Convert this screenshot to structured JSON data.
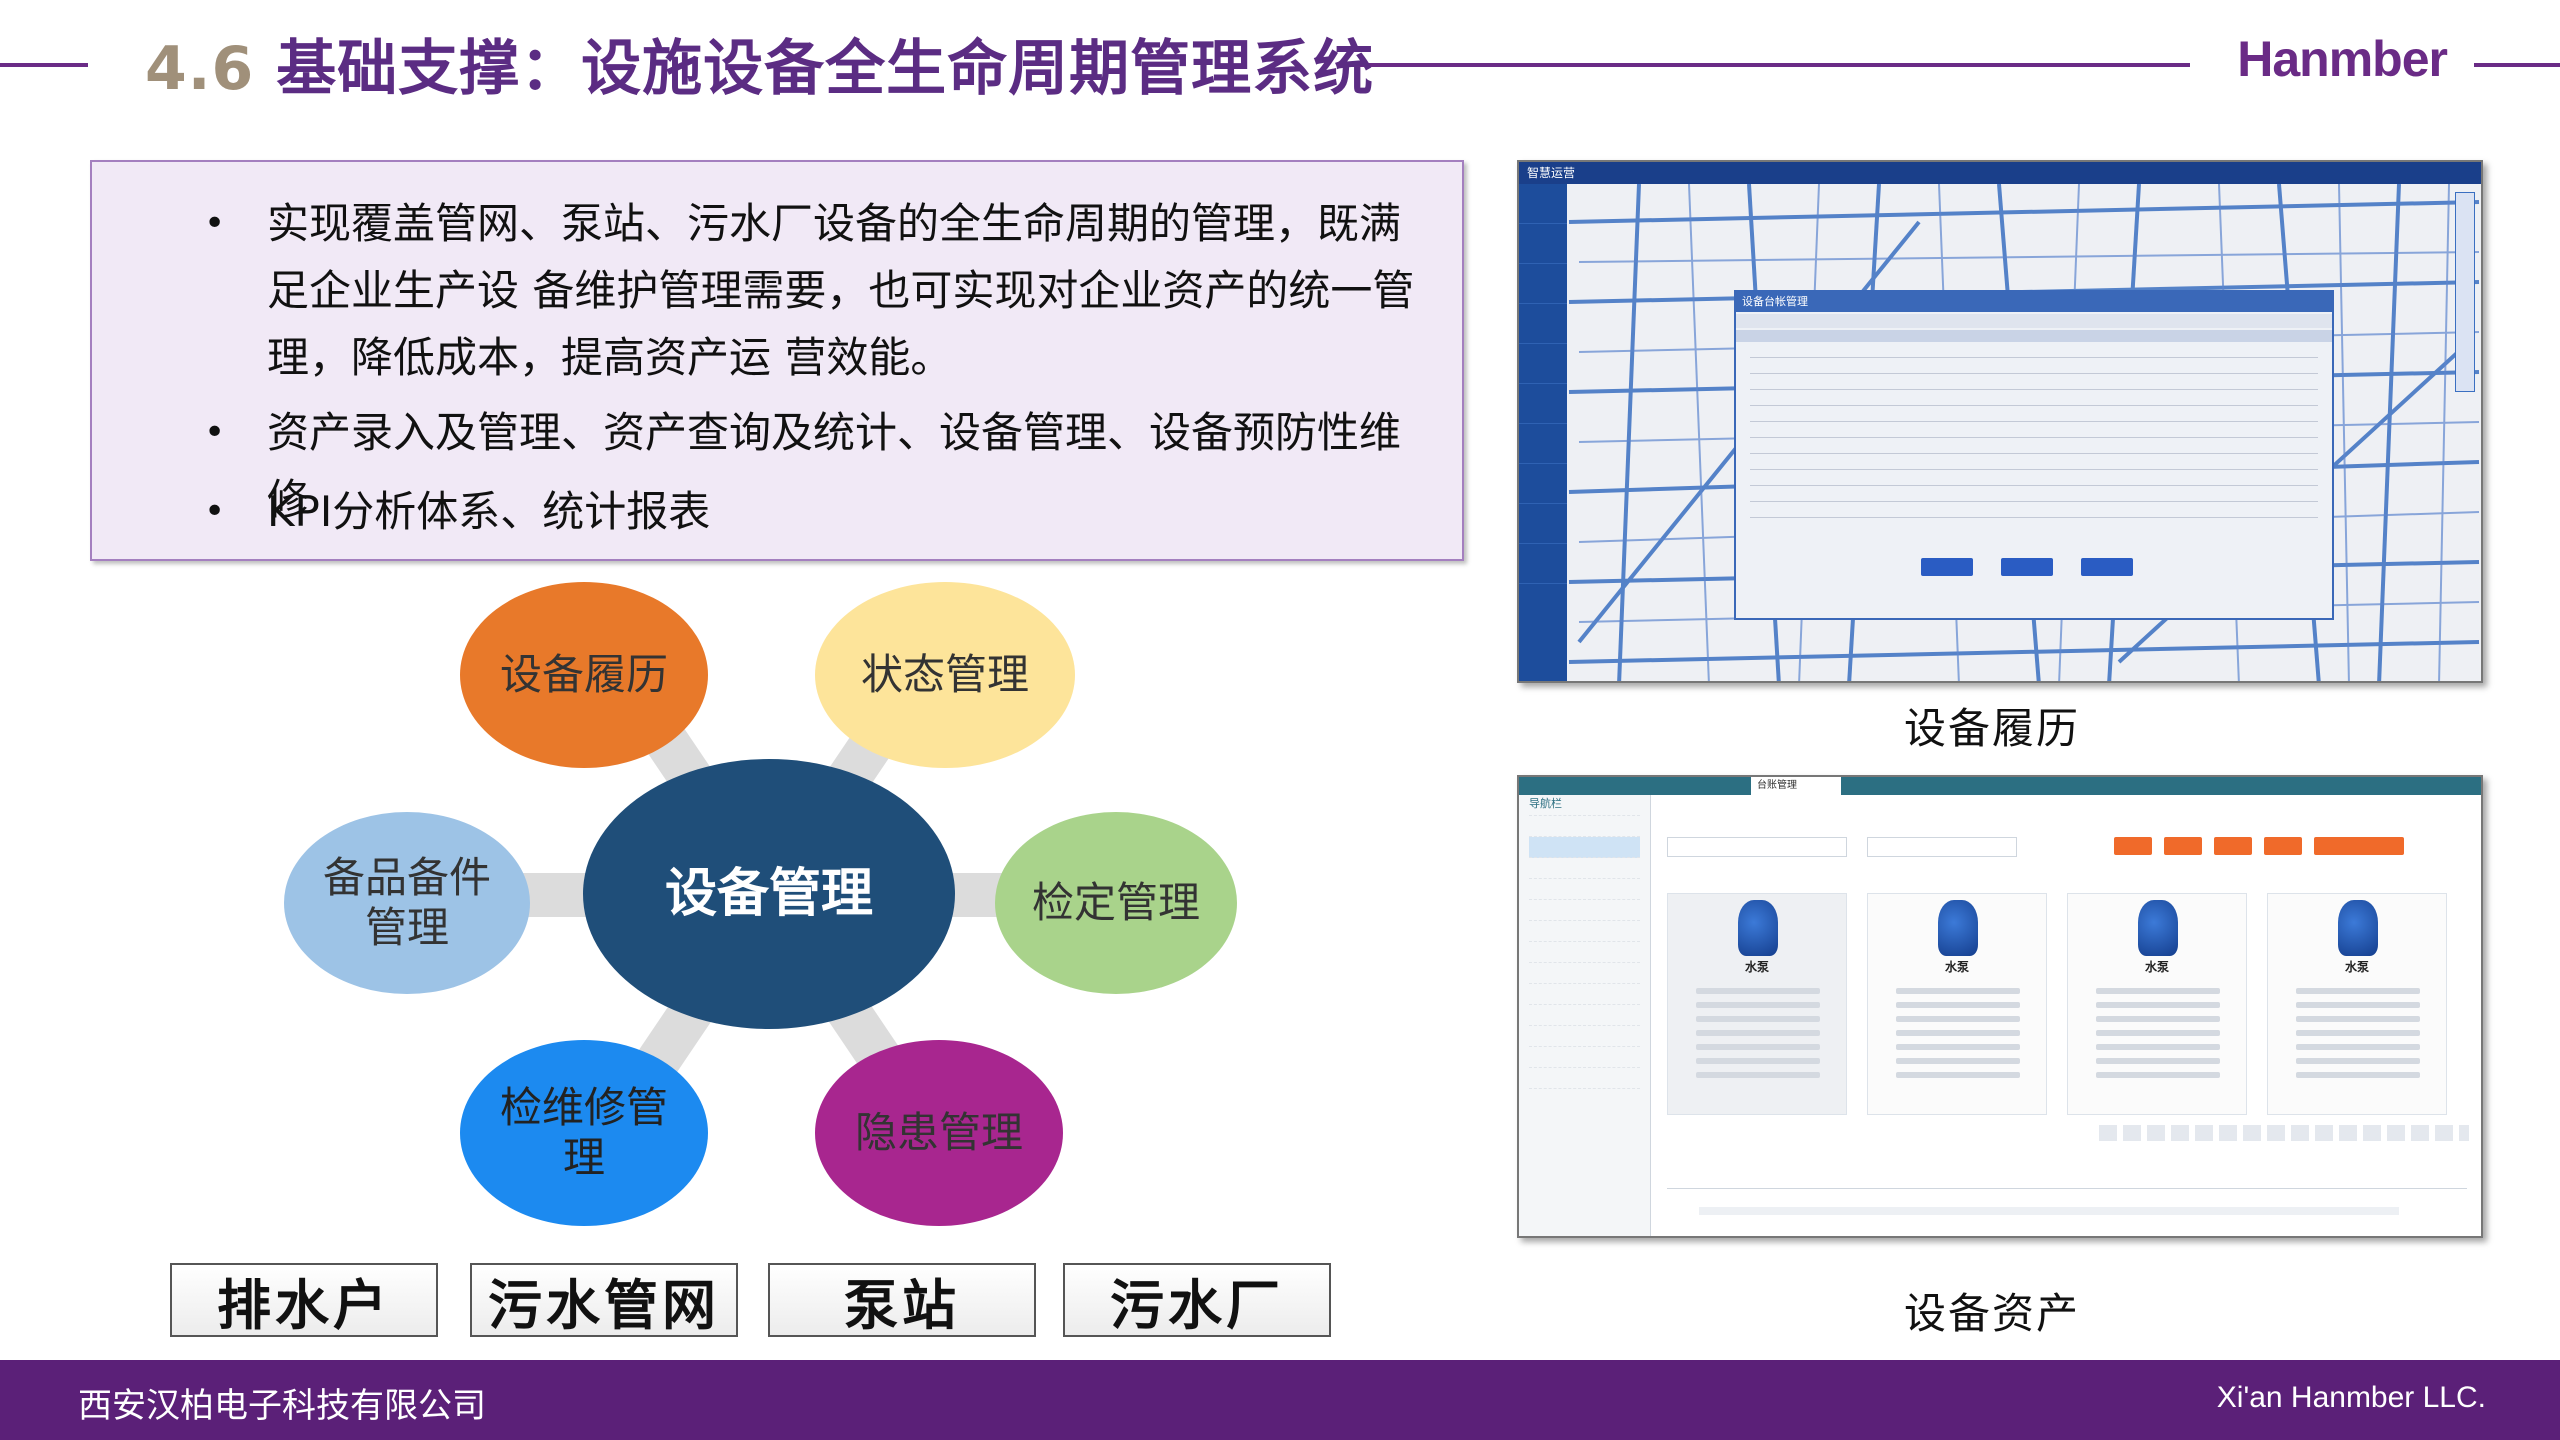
{
  "header": {
    "section_number": "4.6",
    "title": "基础支撑：设施设备全生命周期管理系统",
    "brand": "Hanmber",
    "accent_color": "#6a2b86"
  },
  "bullets": [
    "实现覆盖管网、泵站、污水厂设备的全生命周期的管理，既满足企业生产设 备维护管理需要，也可实现对企业资产的统一管理，降低成本，提高资产运 营效能。",
    "资产录入及管理、资产查询及统计、设备管理、设备预防性维修",
    "KPI分析体系、统计报表"
  ],
  "diagram": {
    "center": {
      "label": "设备管理",
      "color": "#1f4e79"
    },
    "nodes": [
      {
        "label": "设备履历",
        "color": "#e8792a"
      },
      {
        "label": "状态管理",
        "color": "#fde49a"
      },
      {
        "label": "检定管理",
        "color": "#a9d38b"
      },
      {
        "label": "隐患管理",
        "color": "#a8268f"
      },
      {
        "label": "检维修管理",
        "color": "#1c8af0"
      },
      {
        "label": "备品备件管理",
        "color": "#9dc3e6"
      }
    ]
  },
  "bottom_boxes": [
    "排水户",
    "污水管网",
    "泵站",
    "污水厂"
  ],
  "screenshots": [
    {
      "caption": "设备履历",
      "app_title": "智慧运营",
      "dialog_title": "设备台帐管理"
    },
    {
      "caption": "设备资产",
      "nav_title": "导航栏",
      "tab": "台账管理",
      "card_title": "水泵"
    }
  ],
  "footer": {
    "company_cn": "西安汉柏电子科技有限公司",
    "company_en": "Xi'an Hanmber LLC.",
    "color": "#5b2078"
  }
}
